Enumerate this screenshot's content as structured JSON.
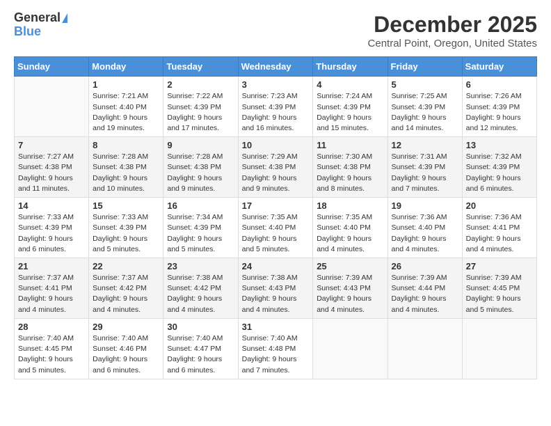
{
  "header": {
    "logo_general": "General",
    "logo_blue": "Blue",
    "month_title": "December 2025",
    "location": "Central Point, Oregon, United States"
  },
  "weekdays": [
    "Sunday",
    "Monday",
    "Tuesday",
    "Wednesday",
    "Thursday",
    "Friday",
    "Saturday"
  ],
  "weeks": [
    [
      {
        "day": "",
        "info": ""
      },
      {
        "day": "1",
        "info": "Sunrise: 7:21 AM\nSunset: 4:40 PM\nDaylight: 9 hours\nand 19 minutes."
      },
      {
        "day": "2",
        "info": "Sunrise: 7:22 AM\nSunset: 4:39 PM\nDaylight: 9 hours\nand 17 minutes."
      },
      {
        "day": "3",
        "info": "Sunrise: 7:23 AM\nSunset: 4:39 PM\nDaylight: 9 hours\nand 16 minutes."
      },
      {
        "day": "4",
        "info": "Sunrise: 7:24 AM\nSunset: 4:39 PM\nDaylight: 9 hours\nand 15 minutes."
      },
      {
        "day": "5",
        "info": "Sunrise: 7:25 AM\nSunset: 4:39 PM\nDaylight: 9 hours\nand 14 minutes."
      },
      {
        "day": "6",
        "info": "Sunrise: 7:26 AM\nSunset: 4:39 PM\nDaylight: 9 hours\nand 12 minutes."
      }
    ],
    [
      {
        "day": "7",
        "info": "Sunrise: 7:27 AM\nSunset: 4:38 PM\nDaylight: 9 hours\nand 11 minutes."
      },
      {
        "day": "8",
        "info": "Sunrise: 7:28 AM\nSunset: 4:38 PM\nDaylight: 9 hours\nand 10 minutes."
      },
      {
        "day": "9",
        "info": "Sunrise: 7:28 AM\nSunset: 4:38 PM\nDaylight: 9 hours\nand 9 minutes."
      },
      {
        "day": "10",
        "info": "Sunrise: 7:29 AM\nSunset: 4:38 PM\nDaylight: 9 hours\nand 9 minutes."
      },
      {
        "day": "11",
        "info": "Sunrise: 7:30 AM\nSunset: 4:38 PM\nDaylight: 9 hours\nand 8 minutes."
      },
      {
        "day": "12",
        "info": "Sunrise: 7:31 AM\nSunset: 4:39 PM\nDaylight: 9 hours\nand 7 minutes."
      },
      {
        "day": "13",
        "info": "Sunrise: 7:32 AM\nSunset: 4:39 PM\nDaylight: 9 hours\nand 6 minutes."
      }
    ],
    [
      {
        "day": "14",
        "info": "Sunrise: 7:33 AM\nSunset: 4:39 PM\nDaylight: 9 hours\nand 6 minutes."
      },
      {
        "day": "15",
        "info": "Sunrise: 7:33 AM\nSunset: 4:39 PM\nDaylight: 9 hours\nand 5 minutes."
      },
      {
        "day": "16",
        "info": "Sunrise: 7:34 AM\nSunset: 4:39 PM\nDaylight: 9 hours\nand 5 minutes."
      },
      {
        "day": "17",
        "info": "Sunrise: 7:35 AM\nSunset: 4:40 PM\nDaylight: 9 hours\nand 5 minutes."
      },
      {
        "day": "18",
        "info": "Sunrise: 7:35 AM\nSunset: 4:40 PM\nDaylight: 9 hours\nand 4 minutes."
      },
      {
        "day": "19",
        "info": "Sunrise: 7:36 AM\nSunset: 4:40 PM\nDaylight: 9 hours\nand 4 minutes."
      },
      {
        "day": "20",
        "info": "Sunrise: 7:36 AM\nSunset: 4:41 PM\nDaylight: 9 hours\nand 4 minutes."
      }
    ],
    [
      {
        "day": "21",
        "info": "Sunrise: 7:37 AM\nSunset: 4:41 PM\nDaylight: 9 hours\nand 4 minutes."
      },
      {
        "day": "22",
        "info": "Sunrise: 7:37 AM\nSunset: 4:42 PM\nDaylight: 9 hours\nand 4 minutes."
      },
      {
        "day": "23",
        "info": "Sunrise: 7:38 AM\nSunset: 4:42 PM\nDaylight: 9 hours\nand 4 minutes."
      },
      {
        "day": "24",
        "info": "Sunrise: 7:38 AM\nSunset: 4:43 PM\nDaylight: 9 hours\nand 4 minutes."
      },
      {
        "day": "25",
        "info": "Sunrise: 7:39 AM\nSunset: 4:43 PM\nDaylight: 9 hours\nand 4 minutes."
      },
      {
        "day": "26",
        "info": "Sunrise: 7:39 AM\nSunset: 4:44 PM\nDaylight: 9 hours\nand 4 minutes."
      },
      {
        "day": "27",
        "info": "Sunrise: 7:39 AM\nSunset: 4:45 PM\nDaylight: 9 hours\nand 5 minutes."
      }
    ],
    [
      {
        "day": "28",
        "info": "Sunrise: 7:40 AM\nSunset: 4:45 PM\nDaylight: 9 hours\nand 5 minutes."
      },
      {
        "day": "29",
        "info": "Sunrise: 7:40 AM\nSunset: 4:46 PM\nDaylight: 9 hours\nand 6 minutes."
      },
      {
        "day": "30",
        "info": "Sunrise: 7:40 AM\nSunset: 4:47 PM\nDaylight: 9 hours\nand 6 minutes."
      },
      {
        "day": "31",
        "info": "Sunrise: 7:40 AM\nSunset: 4:48 PM\nDaylight: 9 hours\nand 7 minutes."
      },
      {
        "day": "",
        "info": ""
      },
      {
        "day": "",
        "info": ""
      },
      {
        "day": "",
        "info": ""
      }
    ]
  ]
}
